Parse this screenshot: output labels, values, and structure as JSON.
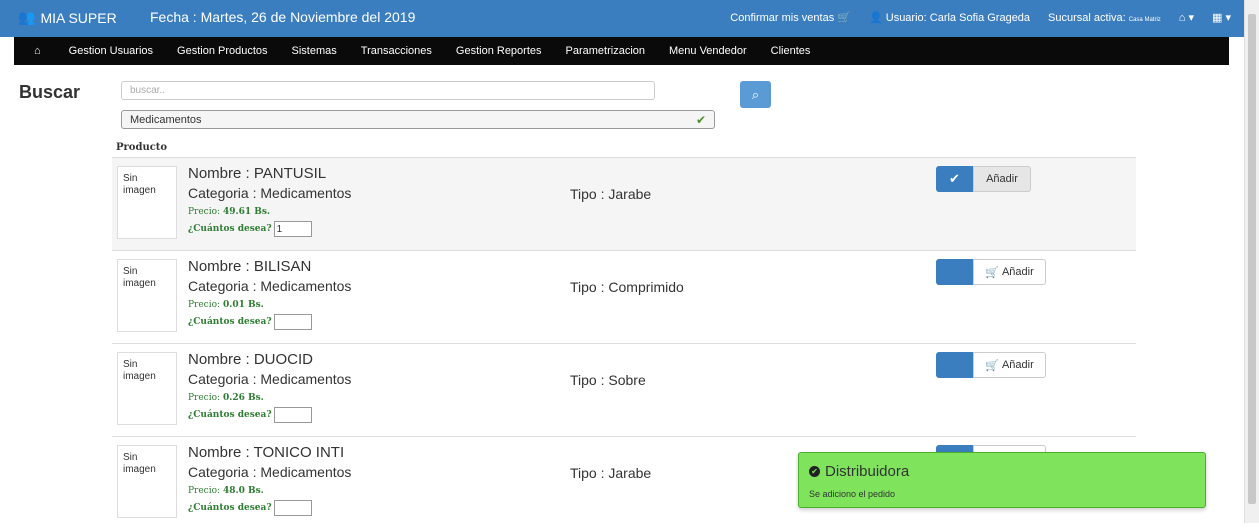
{
  "header": {
    "brand": "MIA SUPER",
    "brand_icon": "users-icon",
    "date": "Fecha : Martes, 26 de Noviembre del 2019",
    "confirm_sales": "Confirmar mis ventas",
    "user": "Usuario: Carla Sofia Grageda",
    "branch_label": "Sucursal activa:",
    "branch_value": "Casa Matriz"
  },
  "nav": {
    "items": [
      {
        "label": "Gestion Usuarios"
      },
      {
        "label": "Gestion Productos"
      },
      {
        "label": "Sistemas"
      },
      {
        "label": "Transacciones"
      },
      {
        "label": "Gestion Reportes"
      },
      {
        "label": "Parametrizacion"
      },
      {
        "label": "Menu Vendedor"
      },
      {
        "label": "Clientes"
      }
    ]
  },
  "search": {
    "label": "Buscar",
    "placeholder": "buscar..",
    "category_selected": "Medicamentos"
  },
  "table": {
    "column_header": "Producto",
    "image_alt": "Sin imagen",
    "quantity_label": "¿Cuántos desea?",
    "price_label": "Precio:",
    "add_label": "Añadir",
    "rows": [
      {
        "nombre": "Nombre : PANTUSIL",
        "categoria": "Categoria : Medicamentos",
        "precio": "49.61 Bs.",
        "cantidad": "1",
        "tipo": "Tipo : Jarabe"
      },
      {
        "nombre": "Nombre : BILISAN",
        "categoria": "Categoria : Medicamentos",
        "precio": "0.01 Bs.",
        "cantidad": "",
        "tipo": "Tipo : Comprimido"
      },
      {
        "nombre": "Nombre : DUOCID",
        "categoria": "Categoria : Medicamentos",
        "precio": "0.26 Bs.",
        "cantidad": "",
        "tipo": "Tipo : Sobre"
      },
      {
        "nombre": "Nombre : TONICO INTI",
        "categoria": "Categoria : Medicamentos",
        "precio": "48.0 Bs.",
        "cantidad": "",
        "tipo": "Tipo : Jarabe"
      }
    ]
  },
  "toast": {
    "title": "Distribuidora",
    "message": "Se adiciono el pedido"
  },
  "colors": {
    "header_bg": "#3a7ec0",
    "navbar_bg": "#0a0a0a",
    "toast_bg": "#7fe45c",
    "price_green": "#2e7d32"
  }
}
